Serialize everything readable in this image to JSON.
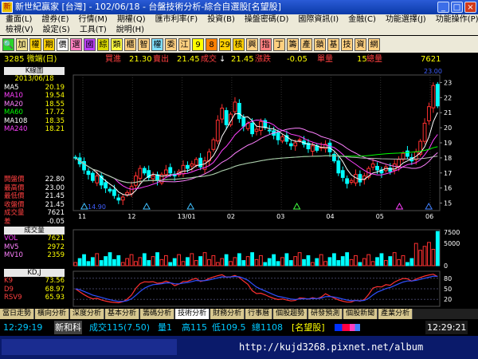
{
  "window": {
    "title": "新世紀贏家 [台灣] - 102/06/18 - 台盤技術分析-綜合自選股[名望股]",
    "icon": "app-icon"
  },
  "menu1": [
    "畫面(L)",
    "證券(E)",
    "行情(M)",
    "期權(Q)",
    "匯市利率(F)",
    "投資(B)",
    "操盤密碼(D)",
    "國際資訊(I)",
    "金融(C)",
    "功能選擇(J)",
    "功能操作(P)"
  ],
  "menu2": [
    "檢視(V)",
    "設定(S)",
    "工具(T)",
    "說明(H)"
  ],
  "toolbar": [
    "加",
    "權",
    "期",
    "價",
    "選",
    "國",
    "綜",
    "類",
    "櫃",
    "智",
    "權",
    "委",
    "江",
    "9",
    "8",
    "29",
    "核",
    "興",
    "指",
    "丁",
    "籌",
    "產",
    "鎖",
    "基",
    "技",
    "資",
    "網"
  ],
  "quote": {
    "code": "3285 微端(日)",
    "buy_label": "買進",
    "buy": "21.30",
    "sell_label": "賣出",
    "sell": "21.45",
    "deal_label": "成交",
    "arrow": "↓",
    "deal": "21.45",
    "chg_label": "漲跌",
    "chg": "-0.05",
    "vol_label": "單量",
    "vol": "15",
    "total_label": "總量",
    "total": "7621"
  },
  "kpanel": {
    "title": "K線圖",
    "date": "2013/06/18",
    "ma": [
      {
        "label": "MA5",
        "value": "20.19",
        "color": "#ffffff"
      },
      {
        "label": "MA10",
        "value": "19.54",
        "color": "#ff40ff"
      },
      {
        "label": "MA20",
        "value": "18.55",
        "color": "#ff80ff"
      },
      {
        "label": "MA60",
        "value": "17.72",
        "color": "#00ff00"
      },
      {
        "label": "MA108",
        "value": "18.35",
        "color": "#ffffff"
      },
      {
        "label": "MA240",
        "value": "18.21",
        "color": "#ff40ff"
      }
    ],
    "ohlc": [
      {
        "label": "開盤價",
        "value": "22.80"
      },
      {
        "label": "最高價",
        "value": "23.00"
      },
      {
        "label": "最低價",
        "value": "21.45"
      },
      {
        "label": "收盤價",
        "value": "21.45"
      },
      {
        "label": "成交量",
        "value": "7621"
      },
      {
        "label": "差",
        "value": "-0.05"
      }
    ],
    "yticks": [
      "23",
      "22",
      "21",
      "20",
      "19",
      "18",
      "17",
      "16",
      "15"
    ],
    "xticks": [
      "11",
      "12",
      "13/01",
      "02",
      "03",
      "04",
      "05",
      "06"
    ],
    "high_mark": "23.00",
    "low_mark": "14.90"
  },
  "vpanel": {
    "title": "成交量",
    "rows": [
      {
        "label": "VOL",
        "value": "7621",
        "color": "#ff40ff"
      },
      {
        "label": "MV5",
        "value": "2972",
        "color": "#ff80ff"
      },
      {
        "label": "MV10",
        "value": "2359",
        "color": "#ff80ff"
      }
    ],
    "yticks": [
      "7500",
      "5000",
      "0"
    ]
  },
  "kdpanel": {
    "title": "KD,J",
    "rows": [
      {
        "label": "K9",
        "value": "73.56",
        "color": "#ff4040"
      },
      {
        "label": "D9",
        "value": "68.97",
        "color": "#ff4040"
      },
      {
        "label": "RSV9",
        "value": "65.93",
        "color": "#ff4040"
      }
    ],
    "yticks": [
      "80",
      "50",
      "20"
    ]
  },
  "tabs": [
    "當日走勢",
    "橫向分析",
    "深度分析",
    "基本分析",
    "籌碼分析",
    "技術分析",
    "財務分析",
    "行事曆",
    "個股趨勢",
    "研發預測",
    "個股新聞",
    "產業分析"
  ],
  "active_tab": "技術分析",
  "status": {
    "time": "12:29:19",
    "name": "新和科",
    "deal": "成交115(7.50)",
    "qty": "量1",
    "high": "高115",
    "low": "低109.5",
    "total": "總1108",
    "group": "[名望股]",
    "clock": "12:29:21"
  },
  "bottom": {
    "url": "http://kujd3268.pixnet.net/album"
  },
  "colors": {
    "up": "#ff3030",
    "down": "#00ffff",
    "grid": "#404040"
  },
  "chart_data": {
    "type": "candlestick",
    "ylim": [
      14.5,
      23.5
    ],
    "close": [
      18.0,
      17.6,
      17.2,
      16.9,
      16.5,
      16.8,
      16.2,
      16.0,
      15.8,
      15.5,
      15.2,
      15.4,
      15.7,
      16.1,
      16.8,
      17.3,
      17.0,
      16.7,
      16.8,
      16.5,
      16.9,
      17.2,
      17.0,
      16.8,
      17.1,
      17.5,
      17.3,
      17.6,
      17.9,
      17.4,
      17.8,
      18.4,
      19.2,
      20.5,
      21.3,
      20.2,
      20.9,
      21.7,
      20.6,
      20.1,
      20.3,
      19.6,
      19.9,
      20.4,
      20.0,
      19.8,
      19.5,
      19.2,
      19.4,
      19.1,
      18.8,
      19.0,
      19.2,
      18.9,
      18.6,
      18.8,
      18.5,
      18.7,
      18.9,
      18.4,
      17.8,
      17.0,
      16.7,
      16.3,
      16.5,
      16.9,
      16.4,
      16.8,
      17.3,
      17.6,
      17.2,
      17.0,
      17.4,
      17.1,
      17.6,
      17.9,
      18.3,
      18.1,
      17.8,
      18.4,
      19.1,
      20.3,
      21.4,
      22.8,
      21.45
    ]
  }
}
